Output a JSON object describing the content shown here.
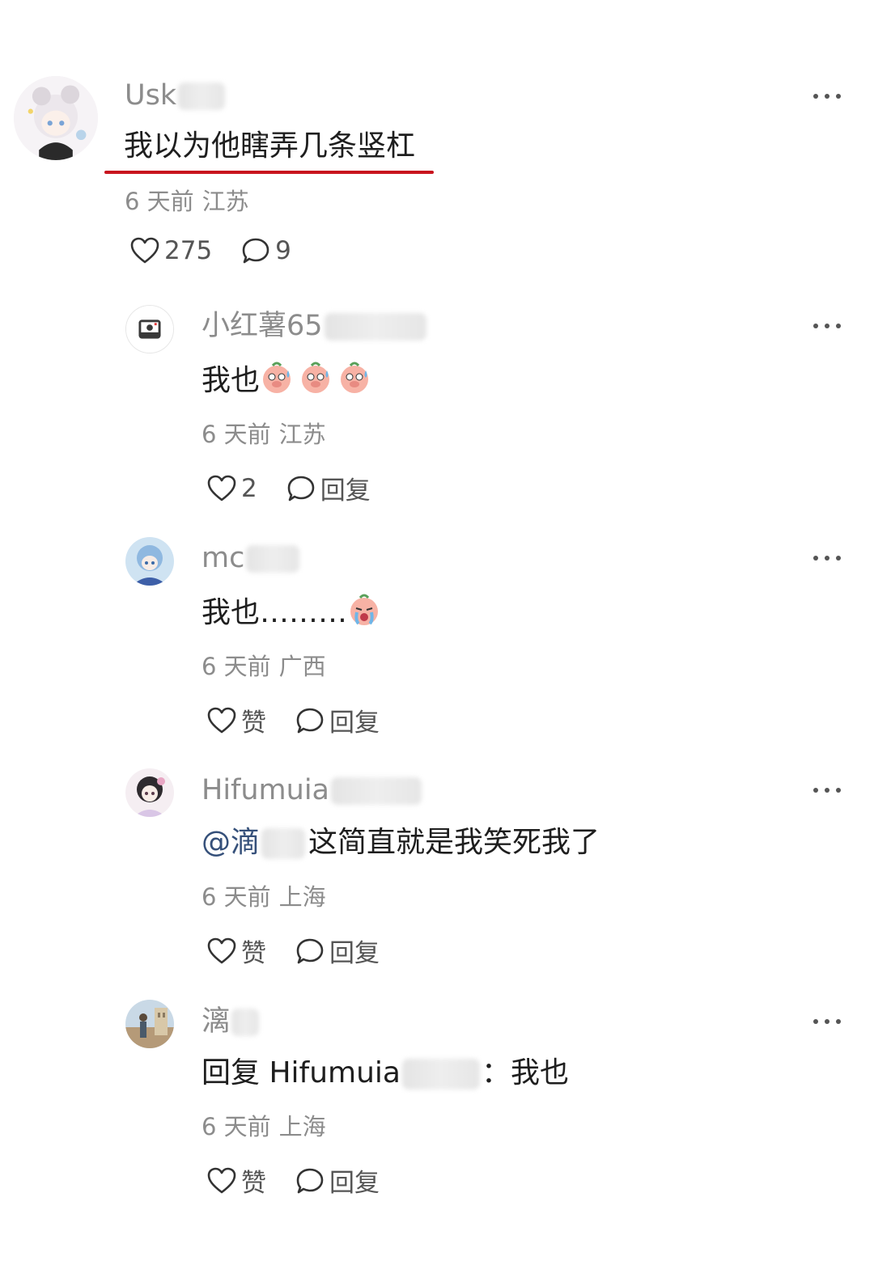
{
  "comments": [
    {
      "author": "Usk",
      "avatar": "anime-white-hair-avatar",
      "text": "我以为他瞎弄几条竖杠",
      "time": "6 天前",
      "location": "江苏",
      "likes": "275",
      "replies": "9",
      "highlight_color": "#c8141e"
    },
    {
      "author": "小红薯65",
      "avatar": "camera-default-avatar",
      "text": "我也",
      "emojis": [
        "sweating-pig-emoji",
        "sweating-pig-emoji",
        "sweating-pig-emoji"
      ],
      "time": "6 天前",
      "location": "江苏",
      "likes": "2",
      "reply_label": "回复"
    },
    {
      "author": "mc",
      "avatar": "anime-blue-hair-avatar",
      "text": "我也………",
      "emojis": [
        "crying-pig-emoji"
      ],
      "time": "6 天前",
      "location": "广西",
      "likes": "赞",
      "reply_label": "回复"
    },
    {
      "author": "Hifumuia",
      "avatar": "anime-dark-hair-avatar",
      "mention": "@滴",
      "text": "这简直就是我笑死我了",
      "time": "6 天前",
      "location": "上海",
      "likes": "赞",
      "reply_label": "回复"
    },
    {
      "author": "漓",
      "avatar": "scenery-avatar",
      "reply_prefix": "回复 Hifumuia",
      "text": "：我也",
      "time": "6 天前",
      "location": "上海",
      "likes": "赞",
      "reply_label": "回复"
    }
  ]
}
